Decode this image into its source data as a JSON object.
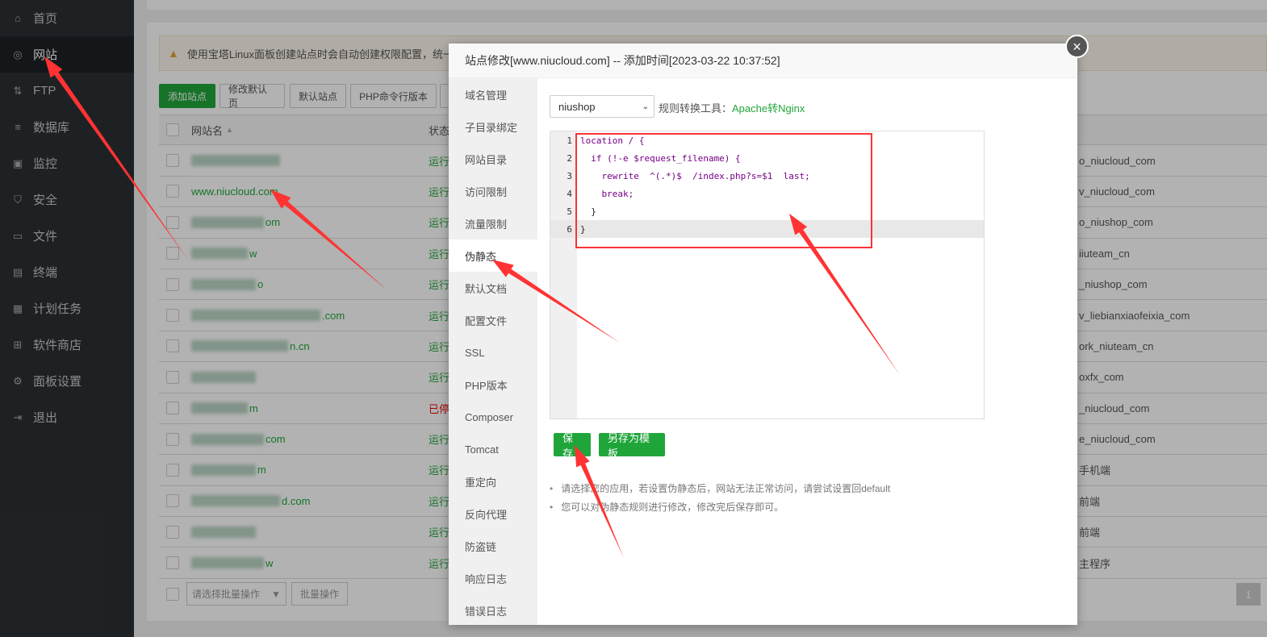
{
  "sidebar": {
    "items": [
      {
        "label": "首页",
        "icon": "home-icon"
      },
      {
        "label": "网站",
        "icon": "globe-icon",
        "active": true
      },
      {
        "label": "FTP",
        "icon": "ftp-icon"
      },
      {
        "label": "数据库",
        "icon": "database-icon"
      },
      {
        "label": "监控",
        "icon": "monitor-icon"
      },
      {
        "label": "安全",
        "icon": "shield-icon"
      },
      {
        "label": "文件",
        "icon": "folder-icon"
      },
      {
        "label": "终端",
        "icon": "terminal-icon"
      },
      {
        "label": "计划任务",
        "icon": "calendar-icon"
      },
      {
        "label": "软件商店",
        "icon": "apps-icon"
      },
      {
        "label": "面板设置",
        "icon": "gear-icon"
      },
      {
        "label": "退出",
        "icon": "logout-icon"
      }
    ]
  },
  "notice": "使用宝塔Linux面板创建站点时会自动创建权限配置，统一使用",
  "toolbar": [
    "添加站点",
    "修改默认页",
    "默认站点",
    "PHP命令行版本"
  ],
  "table": {
    "headers": {
      "name": "网站名",
      "status": "状态"
    },
    "rows": [
      {
        "name": "",
        "status": "运行",
        "ps": "o_niucloud_com"
      },
      {
        "name": "www.niucloud.com",
        "status": "运行",
        "ps": "v_niucloud_com"
      },
      {
        "name": "om",
        "status": "运行",
        "ps": "o_niushop_com"
      },
      {
        "name": "w",
        "status": "运行",
        "ps": "iiuteam_cn"
      },
      {
        "name": "o",
        "status": "运行",
        "ps": "_niushop_com"
      },
      {
        "name": ".com",
        "status": "运行",
        "ps": "v_liebianxiaofeixia_com"
      },
      {
        "name": "n.cn",
        "status": "运行",
        "ps": "ork_niuteam_cn"
      },
      {
        "name": "",
        "status": "运行",
        "ps": "oxfx_com"
      },
      {
        "name": "m",
        "status": "已停",
        "ps": "_niucloud_com"
      },
      {
        "name": "com",
        "status": "运行",
        "ps": "e_niucloud_com"
      },
      {
        "name": "m",
        "status": "运行",
        "ps": "手机端"
      },
      {
        "name": "d.com",
        "status": "运行",
        "ps": "前端"
      },
      {
        "name": "",
        "status": "运行",
        "ps": "前端"
      },
      {
        "name": "w",
        "status": "运行",
        "ps": "主程序"
      }
    ]
  },
  "footer": {
    "batch_placeholder": "请选择批量操作",
    "batch_button": "批量操作",
    "page": "1"
  },
  "modal": {
    "title": "站点修改[www.niucloud.com] -- 添加时间[2023-03-22 10:37:52]",
    "close": "×",
    "nav": [
      "域名管理",
      "子目录绑定",
      "网站目录",
      "访问限制",
      "流量限制",
      "伪静态",
      "默认文档",
      "配置文件",
      "SSL",
      "PHP版本",
      "Composer",
      "Tomcat",
      "重定向",
      "反向代理",
      "防盗链",
      "响应日志",
      "错误日志"
    ],
    "active_nav": "伪静态",
    "select_value": "niushop",
    "tool_label": "规则转换工具：",
    "tool_link": "Apache转Nginx",
    "code_lines": [
      "location / {",
      "  if (!-e $request_filename) {",
      "    rewrite  ^(.*)$  /index.php?s=$1  last;",
      "    break;",
      "  }",
      "}"
    ],
    "save": "保存",
    "save_template": "另存为模板",
    "tips": [
      "请选择您的应用，若设置伪静态后，网站无法正常访问，请尝试设置回default",
      "您可以对伪静态规则进行修改，修改完后保存即可。"
    ]
  },
  "colors": {
    "accent": "#20a53a",
    "annotation": "#ff3333",
    "stopped": "#ef0808"
  }
}
